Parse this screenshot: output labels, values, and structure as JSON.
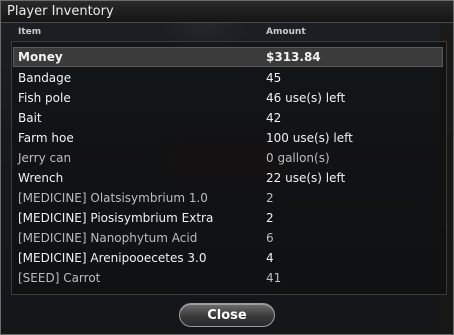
{
  "window": {
    "title": "Player Inventory"
  },
  "columns": {
    "item": "Item",
    "amount": "Amount"
  },
  "rows": [
    {
      "name": "Money",
      "amount": "$313.84"
    },
    {
      "name": "Bandage",
      "amount": "45"
    },
    {
      "name": "Fish pole",
      "amount": "46 use(s) left"
    },
    {
      "name": "Bait",
      "amount": "42"
    },
    {
      "name": "Farm hoe",
      "amount": "100 use(s) left"
    },
    {
      "name": "Jerry can",
      "amount": "0 gallon(s)"
    },
    {
      "name": "Wrench",
      "amount": "22 use(s) left"
    },
    {
      "name": "[MEDICINE] Olatsisymbrium 1.0",
      "amount": "2"
    },
    {
      "name": "[MEDICINE] Piosisymbrium Extra",
      "amount": "2"
    },
    {
      "name": "[MEDICINE] Nanophytum Acid",
      "amount": "6"
    },
    {
      "name": "[MEDICINE] Arenipooecetes 3.0",
      "amount": "4"
    },
    {
      "name": "[SEED] Carrot",
      "amount": "41"
    }
  ],
  "buttons": {
    "close": "Close"
  }
}
